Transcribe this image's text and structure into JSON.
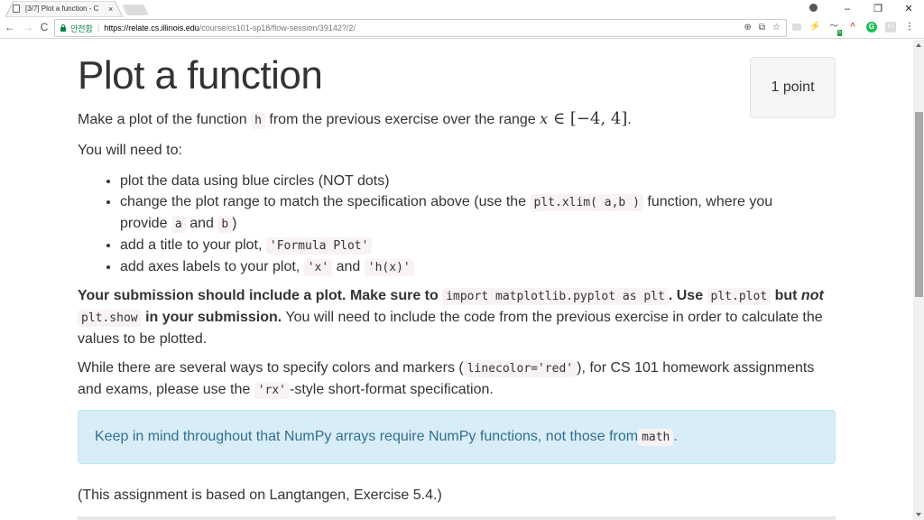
{
  "browser": {
    "tab": {
      "title": "[3/7] Plot a function - C",
      "close": "×"
    },
    "window_controls": {
      "minimize": "–",
      "restore": "❐",
      "close": "✕"
    },
    "nav": {
      "back": "←",
      "forward": "→",
      "reload": "C"
    },
    "address": {
      "secure_label": "안전함",
      "separator": "|",
      "url_scheme_host": "https://relate.cs.illinois.edu",
      "url_path": "/course/cs101-sp18/flow-session/39142?/2/"
    },
    "omnibox_icons": {
      "zoom": "⊕",
      "translate": "⧉",
      "bookmark": "☆"
    },
    "extensions": [
      {
        "name": "cast",
        "glyph": "▭"
      },
      {
        "name": "lightning",
        "glyph": "⚡"
      },
      {
        "name": "pulse",
        "glyph": "〜",
        "badge": "5"
      },
      {
        "name": "chart",
        "glyph": "^"
      },
      {
        "name": "grammarly",
        "glyph": "G"
      },
      {
        "name": "ext-grey",
        "glyph": "EX"
      }
    ],
    "menu": "⋮"
  },
  "page": {
    "title": "Plot a function",
    "points": "1 point",
    "intro": {
      "before": "Make a plot of the function ",
      "code": "h",
      "after": " from the previous exercise over the range ",
      "math_var": "x",
      "math_rest": " ∈ [−4, 4]",
      "end": "."
    },
    "need_to": "You will need to:",
    "requirements": [
      {
        "text": "plot the data using blue circles (NOT dots)"
      },
      {
        "before": "change the plot range to match the specification above (use the ",
        "code1": "plt.xlim( a,b )",
        "mid": " function, where you provide ",
        "code2": "a",
        "and": " and ",
        "code3": "b",
        "end": ")"
      },
      {
        "before": "add a title to your plot, ",
        "code": "'Formula Plot'"
      },
      {
        "before": "add axes labels to your plot, ",
        "code1": "'x'",
        "and": " and ",
        "code2": "'h(x)'"
      }
    ],
    "submission": {
      "bold1": "Your submission should include a plot. Make sure to ",
      "code1": "import matplotlib.pyplot as plt",
      "bold2": ". Use ",
      "code2": "plt.plot",
      "bold3": " but ",
      "italic": "not",
      "code3": "plt.show",
      "bold4": " in your submission.",
      "rest": " You will need to include the code from the previous exercise in order to calculate the values to be plotted."
    },
    "colors_para": {
      "before": "While there are several ways to specify colors and markers (",
      "code1": "linecolor='red'",
      "mid": "), for CS 101 homework assignments and exams, please use the ",
      "code2": "'rx'",
      "end": "-style short-format specification."
    },
    "alert": {
      "before": "Keep in mind throughout that NumPy arrays require NumPy functions, not those from ",
      "code": "math",
      "end": "."
    },
    "attribution": "(This assignment is based on Langtangen, Exercise 5.4.)"
  }
}
